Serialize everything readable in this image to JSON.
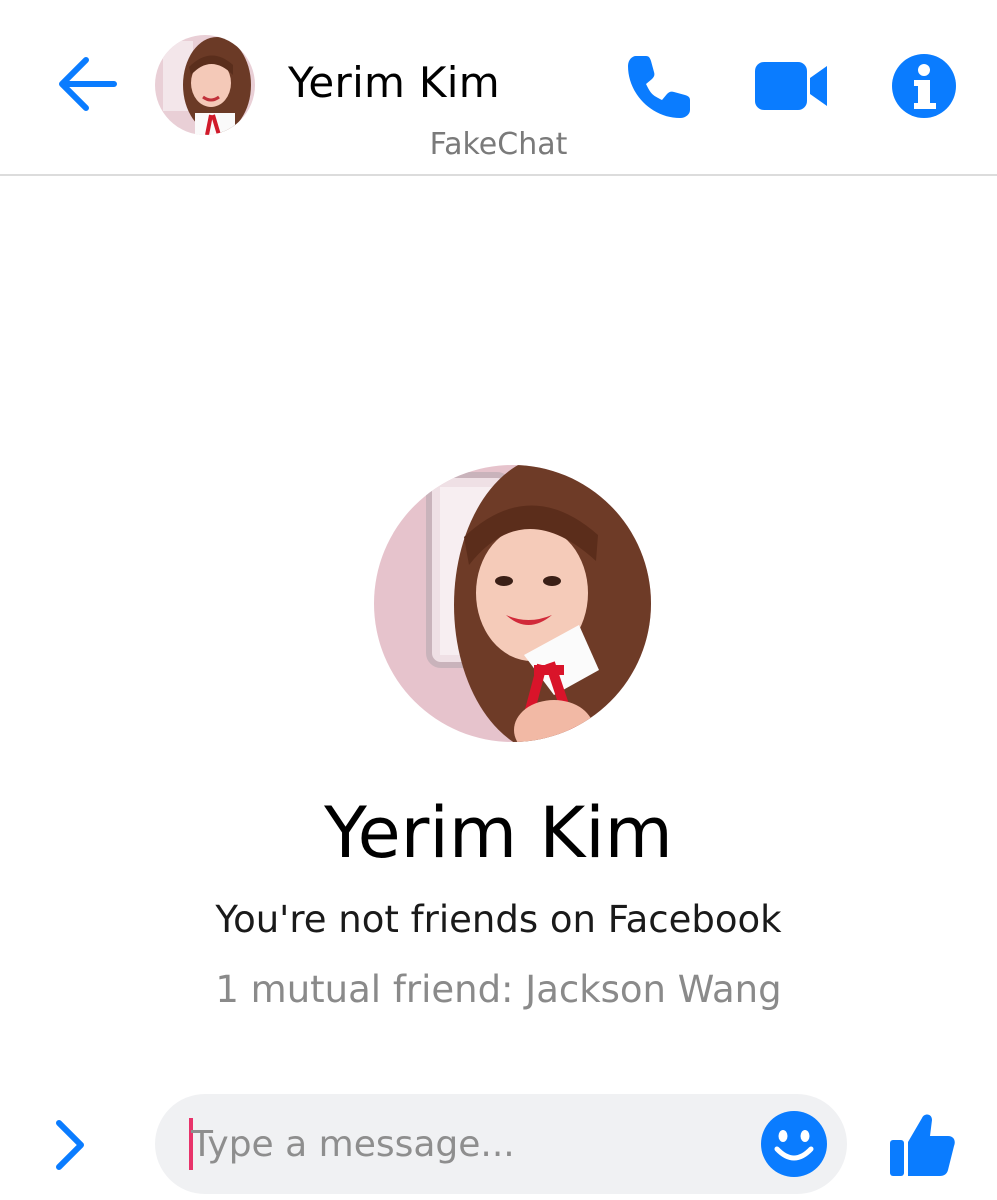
{
  "header": {
    "contact_name": "Yerim Kim",
    "subtitle": "FakeChat"
  },
  "profile": {
    "name": "Yerim Kim",
    "friend_status": "You're not friends on Facebook",
    "mutual_friends": "1 mutual friend: Jackson Wang"
  },
  "composer": {
    "placeholder": "Type a message..."
  },
  "icons": {
    "back": "arrow-left-icon",
    "call": "phone-icon",
    "video": "video-camera-icon",
    "info": "info-icon",
    "expand": "chevron-right-icon",
    "emoji": "smiley-icon",
    "like": "thumbs-up-icon"
  },
  "colors": {
    "accent": "#0a7cff",
    "caret": "#e8336a"
  }
}
